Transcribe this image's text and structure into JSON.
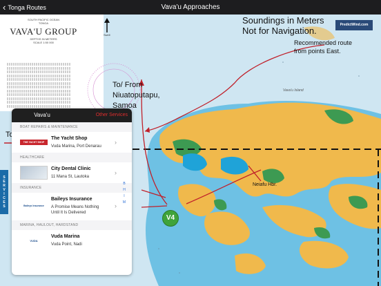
{
  "nav": {
    "back_label": "Tonga Routes",
    "title": "Vava'u Approaches"
  },
  "chart": {
    "country": "TONGA",
    "group_title": "VAVA'U GROUP",
    "depths_note": "DEPTHS IN METERS",
    "scale_note": "SCALE 1:50 000",
    "ocean_note": "SOUTH PACIFIC OCEAN",
    "soundings_line1": "Soundings in Meters",
    "soundings_line2": "Not for Navigation.",
    "recommended_line1": "Recommended route",
    "recommended_line2": "from points East.",
    "to_from_line1": "To/ From",
    "to_from_line2": "Niuatoputapu,",
    "to_from_line3": "Samoa",
    "tonga_label": "To",
    "north_label": "Swell",
    "island_label": "Vava'u Island",
    "harbor_label": "Neiafu Hbr.",
    "waypoint": "V4",
    "brand": "PredictWind.com"
  },
  "panel": {
    "tab_active": "Vava'u",
    "tab_other": "Other Services",
    "sections": [
      {
        "header": "BOAT REPAIRS & MAINTENANCE",
        "title": "The Yacht Shop",
        "sub1": "Vuda Marina, Port Denarau",
        "sub2": "",
        "logo": "THE YACHT SHOP"
      },
      {
        "header": "HEALTHCARE",
        "title": "City Dental Clinic",
        "sub1": "11 Mana St, Lautoka",
        "sub2": "",
        "logo": "dental"
      },
      {
        "header": "INSURANCE",
        "title": "Baileys Insurance",
        "sub1": "A Promise Means Nothing",
        "sub2": "Until It Is Delivered",
        "logo": "Baileys Insurance"
      },
      {
        "header": "MARINA, HAULOUT, HARDSTAND",
        "title": "Vuda Marina",
        "sub1": "Vuda Point, Nadi",
        "sub2": "",
        "logo": "VUDA"
      }
    ],
    "index_letters": [
      "B",
      "H",
      "I",
      "M"
    ],
    "sidebar_label": [
      "S",
      "E",
      "R",
      "V",
      "I",
      "C",
      "E",
      "S"
    ]
  },
  "colors": {
    "land": "#f0b94c",
    "shallow": "#1fa3d8",
    "mangrove": "#3d9a52",
    "sea": "#cfe6f2",
    "route": "#c0202a",
    "navbar": "#1d1d1f",
    "accent_red": "#e02e2e"
  }
}
